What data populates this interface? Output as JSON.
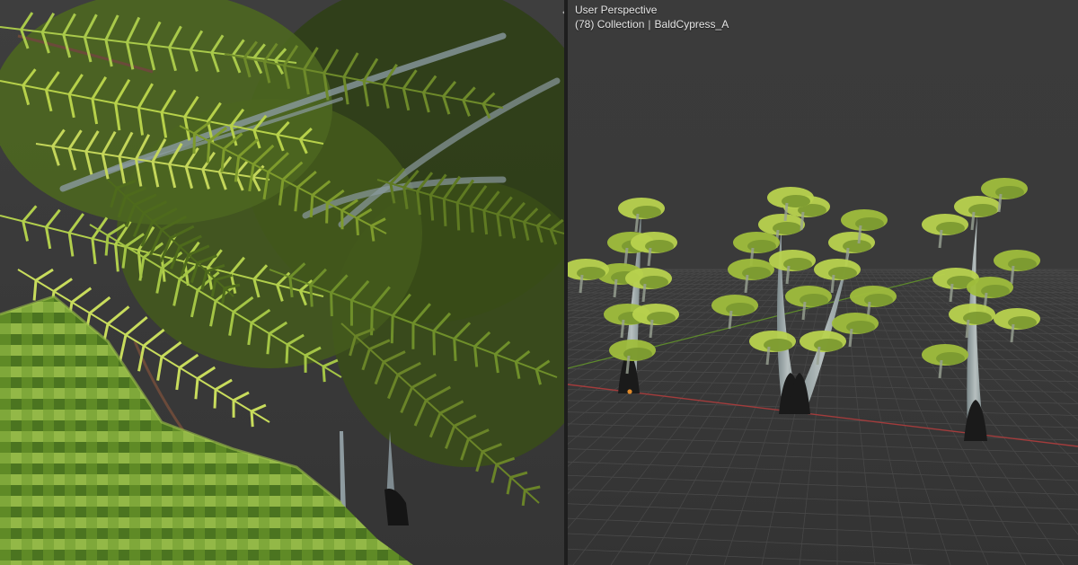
{
  "viewport_left": {
    "content": "close-up of bald cypress foliage"
  },
  "viewport_right": {
    "view_name": "User Perspective",
    "frame": "(78)",
    "collection": "Collection",
    "object": "BaldCypress_A"
  },
  "split_handle_glyph": "‹›",
  "colors": {
    "x_axis": "#a33c3c",
    "y_axis": "#5e8a2c",
    "grid": "#454545",
    "foliage_light": "#b7d14a",
    "foliage_dark": "#3f5a1c"
  }
}
